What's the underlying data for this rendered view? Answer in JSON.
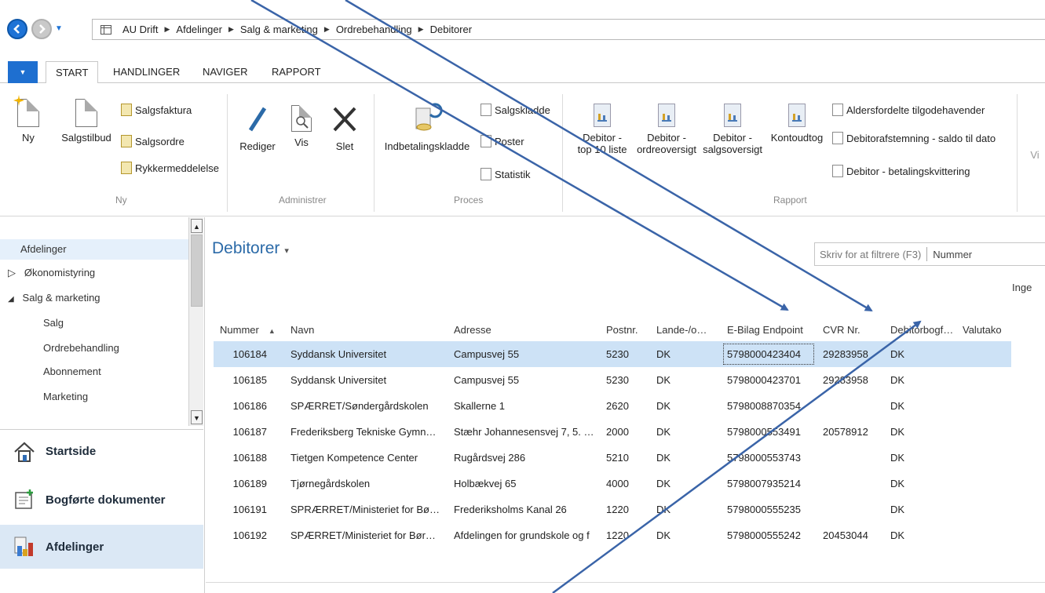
{
  "breadcrumb": [
    "AU Drift",
    "Afdelinger",
    "Salg & marketing",
    "Ordrebehandling",
    "Debitorer"
  ],
  "ribbon_tabs": [
    "START",
    "HANDLINGER",
    "NAVIGER",
    "RAPPORT"
  ],
  "ribbon": {
    "ny_group": {
      "big": [
        "Ny",
        "Salgstilbud"
      ],
      "small": [
        "Salgsfaktura",
        "Salgsordre",
        "Rykkermeddelelse"
      ],
      "label": "Ny"
    },
    "administrer_group": {
      "big": [
        "Rediger",
        "Vis",
        "Slet"
      ],
      "label": "Administrer"
    },
    "proces_group": {
      "big": "Indbetalingskladde",
      "small": [
        "Salgskladde",
        "Poster",
        "Statistik"
      ],
      "label": "Proces"
    },
    "rapport_group": {
      "big": [
        [
          "Debitor -",
          "top 10 liste"
        ],
        [
          "Debitor -",
          "ordreoversigt"
        ],
        [
          "Debitor -",
          "salgsoversigt"
        ],
        [
          "Kontoudtog",
          ""
        ]
      ],
      "small": [
        "Aldersfordelte tilgodehavender",
        "Debitorafstemning - saldo til dato",
        "Debitor - betalingskvittering"
      ],
      "label": "Rapport"
    },
    "cut_label": "Vi"
  },
  "nav_tree": [
    {
      "label": "Afdelinger",
      "indent": 0,
      "prefix": "",
      "selected": true
    },
    {
      "label": "Økonomistyring",
      "indent": 1,
      "prefix": "▷",
      "selected": false
    },
    {
      "label": "Salg & marketing",
      "indent": 1,
      "prefix": "◢",
      "selected": false
    },
    {
      "label": "Salg",
      "indent": 2,
      "prefix": "",
      "selected": false
    },
    {
      "label": "Ordrebehandling",
      "indent": 2,
      "prefix": "",
      "selected": false
    },
    {
      "label": "Abonnement",
      "indent": 2,
      "prefix": "",
      "selected": false
    },
    {
      "label": "Marketing",
      "indent": 2,
      "prefix": "",
      "selected": false
    }
  ],
  "nav_buttons": [
    "Startside",
    "Bogførte dokumenter",
    "Afdelinger"
  ],
  "page": {
    "title": "Debitorer",
    "filter_placeholder": "Skriv for at filtrere (F3)",
    "filter_field": "Nummer",
    "inge_text": "Inge"
  },
  "table": {
    "columns": [
      "Nummer",
      "Navn",
      "Adresse",
      "Postnr.",
      "Lande-/o…",
      "E-Bilag Endpoint",
      "CVR Nr.",
      "Debitorbogf…",
      "Valutako"
    ],
    "rows": [
      [
        "106184",
        "Syddansk Universitet",
        "Campusvej 55",
        "5230",
        "DK",
        "5798000423404",
        "29283958",
        "DK",
        ""
      ],
      [
        "106185",
        "Syddansk Universitet",
        "Campusvej 55",
        "5230",
        "DK",
        "5798000423701",
        "29283958",
        "DK",
        ""
      ],
      [
        "106186",
        "SPÆRRET/Søndergårdskolen",
        "Skallerne 1",
        "2620",
        "DK",
        "5798008870354",
        "",
        "DK",
        ""
      ],
      [
        "106187",
        "Frederiksberg Tekniske Gymn…",
        "Stæhr Johannesensvej 7, 5. …",
        "2000",
        "DK",
        "5798000553491",
        "20578912",
        "DK",
        ""
      ],
      [
        "106188",
        "Tietgen Kompetence Center",
        "Rugårdsvej 286",
        "5210",
        "DK",
        "5798000553743",
        "",
        "DK",
        ""
      ],
      [
        "106189",
        "Tjørnegårdskolen",
        "Holbækvej 65",
        "4000",
        "DK",
        "5798007935214",
        "",
        "DK",
        ""
      ],
      [
        "106191",
        "SPRÆRRET/Ministeriet for Bø…",
        "Frederiksholms Kanal 26",
        "1220",
        "DK",
        "5798000555235",
        "",
        "DK",
        ""
      ],
      [
        "106192",
        "SPÆRRET/Ministeriet for Bør…",
        "Afdelingen for grundskole og f",
        "1220",
        "DK",
        "5798000555242",
        "20453044",
        "DK",
        ""
      ]
    ]
  },
  "colors": {
    "accent": "#2b6aa8",
    "selected_row": "#cde2f6",
    "arrow": "#3a64a8"
  }
}
